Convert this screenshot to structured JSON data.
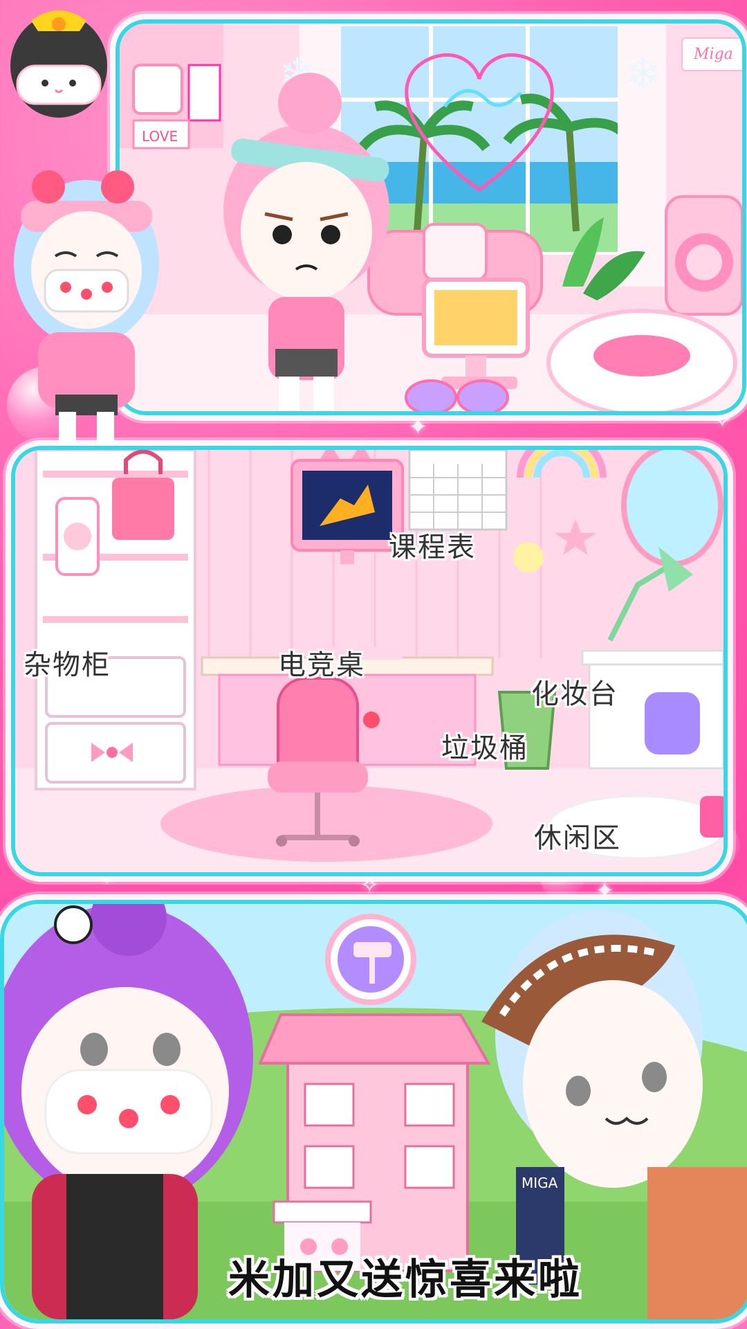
{
  "scene1": {
    "wall_sign": "Miga",
    "poster_text": "LOVE"
  },
  "scene2": {
    "labels": {
      "schedule": "课程表",
      "locker": "杂物柜",
      "gaming_desk": "电竞桌",
      "vanity": "化妆台",
      "trash_can": "垃圾桶",
      "lounge_area": "休闲区"
    }
  },
  "scene3": {
    "building_sign": "MIGA"
  },
  "banner": {
    "text": "米加又送惊喜来啦"
  },
  "colors": {
    "background": "#ff5fb0",
    "panel_border": "#37d7e6",
    "wall": "#ffd9ea",
    "purple_hair": "#b45ee8"
  }
}
